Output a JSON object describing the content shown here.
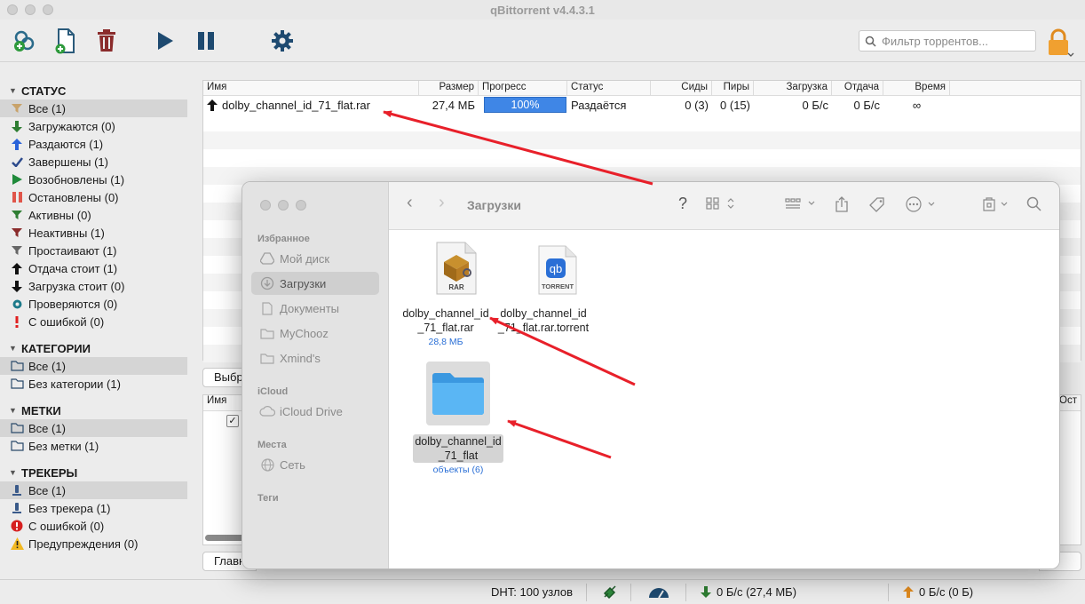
{
  "app": {
    "title": "qBittorrent v4.4.3.1"
  },
  "toolbar": {
    "search_placeholder": "Фильтр торрентов..."
  },
  "sidebar": {
    "status": {
      "title": "СТАТУС",
      "items": [
        {
          "label": "Все (1)",
          "icon": "filter-icon",
          "color": "#c8a26a"
        },
        {
          "label": "Загружаются (0)",
          "icon": "arrow-down-icon",
          "color": "#2e7d32"
        },
        {
          "label": "Раздаются (1)",
          "icon": "arrow-up-icon",
          "color": "#2962d9"
        },
        {
          "label": "Завершены (1)",
          "icon": "check-icon",
          "color": "#2c4a8c"
        },
        {
          "label": "Возобновлены (1)",
          "icon": "play-icon",
          "color": "#1f8a3a"
        },
        {
          "label": "Остановлены (0)",
          "icon": "pause-icon",
          "color": "#e0554a"
        },
        {
          "label": "Активны (0)",
          "icon": "filter-icon",
          "color": "#2e7d32"
        },
        {
          "label": "Неактивны (1)",
          "icon": "filter-icon",
          "color": "#8a2b2b"
        },
        {
          "label": "Простаивают (1)",
          "icon": "filter-icon",
          "color": "#666666"
        },
        {
          "label": "Отдача стоит (1)",
          "icon": "arrow-up-icon",
          "color": "#111111"
        },
        {
          "label": "Загрузка стоит (0)",
          "icon": "arrow-down-icon",
          "color": "#111111"
        },
        {
          "label": "Проверяются (0)",
          "icon": "gear-icon",
          "color": "#1d7a8a"
        },
        {
          "label": "С ошибкой (0)",
          "icon": "exclamation-icon",
          "color": "#e02020"
        }
      ]
    },
    "categories": {
      "title": "КАТЕГОРИИ",
      "items": [
        {
          "label": "Все (1)",
          "icon": "folder-icon"
        },
        {
          "label": "Без категории (1)",
          "icon": "folder-icon"
        }
      ]
    },
    "tags": {
      "title": "МЕТКИ",
      "items": [
        {
          "label": "Все (1)",
          "icon": "folder-icon"
        },
        {
          "label": "Без метки (1)",
          "icon": "folder-icon"
        }
      ]
    },
    "trackers": {
      "title": "ТРЕКЕРЫ",
      "items": [
        {
          "label": "Все (1)",
          "icon": "tracker-icon"
        },
        {
          "label": "Без трекера (1)",
          "icon": "tracker-icon"
        },
        {
          "label": "С ошибкой (0)",
          "icon": "error-icon"
        },
        {
          "label": "Предупреждения (0)",
          "icon": "warning-icon"
        }
      ]
    }
  },
  "torrent_table": {
    "columns": [
      "Имя",
      "Размер",
      "Прогресс",
      "Статус",
      "Сиды",
      "Пиры",
      "Загрузка",
      "Отдача",
      "Время"
    ],
    "rows": [
      {
        "name": "dolby_channel_id_71_flat.rar",
        "size": "27,4 МБ",
        "progress_label": "100%",
        "progress": 1.0,
        "status": "Раздаётся",
        "seeds": "0 (3)",
        "peers": "0 (15)",
        "download": "0 Б/с",
        "upload": "0 Б/с",
        "eta": "∞"
      }
    ]
  },
  "lower_panel": {
    "select_button": "Выбр",
    "col_name": "Имя",
    "col_right": "Ост",
    "general_tab": "Главн",
    "right_tab": "ть"
  },
  "statusbar": {
    "dht": "DHT: 100 узлов",
    "download": "0 Б/с (27,4 МБ)",
    "upload": "0 Б/с (0 Б)"
  },
  "finder": {
    "title": "Загрузки",
    "sidebar": {
      "favorites_title": "Избранное",
      "favorites": [
        {
          "label": "Мой диск",
          "icon": "drive-icon"
        },
        {
          "label": "Загрузки",
          "icon": "downloads-icon"
        },
        {
          "label": "Документы",
          "icon": "document-icon"
        },
        {
          "label": "MyChooz",
          "icon": "folder-icon"
        },
        {
          "label": "Xmind's",
          "icon": "folder-icon"
        }
      ],
      "icloud_title": "iCloud",
      "icloud": [
        {
          "label": "iCloud Drive",
          "icon": "cloud-icon"
        }
      ],
      "network_title": "Места",
      "network": [
        {
          "label": "Сеть",
          "icon": "network-icon"
        }
      ],
      "tags_title": "Теги"
    },
    "files": [
      {
        "name_line1": "dolby_channel_id",
        "name_line2": "_71_flat.rar",
        "sub": "28,8 МБ",
        "icon_label": "RAR"
      },
      {
        "name_line1": "dolby_channel_id",
        "name_line2": "_71_flat.rar.torrent",
        "sub": "",
        "icon_label": "TORRENT",
        "badge": "qb"
      },
      {
        "name_line1": "dolby_channel_id",
        "name_line2": "_71_flat",
        "sub": "объекты (6)"
      }
    ]
  },
  "colors": {
    "progress": "#3f86e6",
    "arrow": "#e8202a",
    "folder": "#4aa8ee"
  }
}
